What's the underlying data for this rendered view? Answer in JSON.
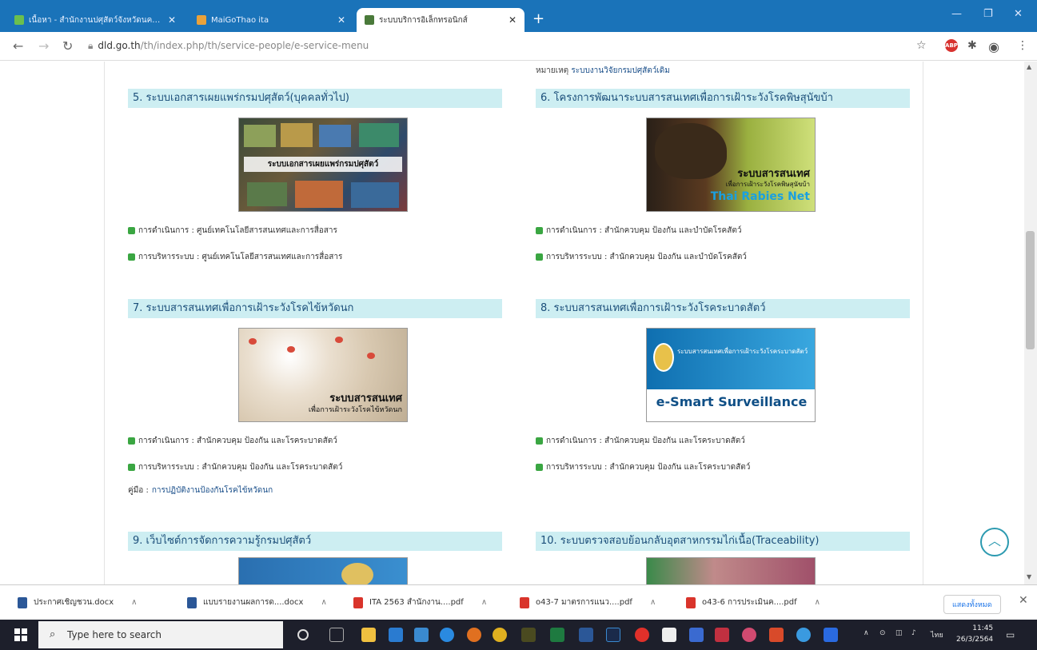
{
  "browser": {
    "tabs": [
      {
        "title": "เนื้อหา - สำนักงานปศุสัตว์จังหวัดนครราชสีมา",
        "active": false
      },
      {
        "title": "MaiGoThao ita",
        "active": false
      },
      {
        "title": "ระบบบริการอิเล็กทรอนิกส์",
        "active": true
      }
    ],
    "url_host": "dld.go.th",
    "url_path": "/th/index.php/th/service-people/e-service-menu"
  },
  "page": {
    "note_label": "หมายเหตุ",
    "note_link": "ระบบงานวิจัยกรมปศุสัตว์เดิม",
    "cards": [
      {
        "header": "5. ระบบเอกสารเผยแพร่กรมปศุสัตว์(บุคคลทั่วไป)",
        "image_text": "ระบบเอกสารเผยแพร่กรมปศุสัตว์",
        "operation": "การดำเนินการ : ศูนย์เทคโนโลยีสารสนเทศและการสื่อสาร",
        "admin": "การบริหารระบบ : ศูนย์เทคโนโลยีสารสนเทศและการสื่อสาร"
      },
      {
        "header": "6. โครงการพัฒนาระบบสารสนเทศเพื่อการเฝ้าระวังโรคพิษสุนัขบ้า",
        "image_text_1": "ระบบสารสนเทศ",
        "image_text_2": "เพื่อการเฝ้าระวังโรคพิษสุนัขบ้า",
        "image_text_3": "Thai Rabies Net",
        "operation": "การดำเนินการ : สำนักควบคุม ป้องกัน และบำบัดโรคสัตว์",
        "admin": "การบริหารระบบ : สำนักควบคุม ป้องกัน และบำบัดโรคสัตว์"
      },
      {
        "header": "7. ระบบสารสนเทศเพื่อการเฝ้าระวังโรคไข้หวัดนก",
        "image_text_1": "ระบบสารสนเทศ",
        "image_text_2": "เพื่อการเฝ้าระวังโรคไข้หวัดนก",
        "operation": "การดำเนินการ : สำนักควบคุม ป้องกัน และโรคระบาดสัตว์",
        "admin": "การบริหารระบบ : สำนักควบคุม ป้องกัน และโรคระบาดสัตว์",
        "manual_label": "คู่มือ :",
        "manual_link": "การปฏิบัติงานป้องกันโรคไข้หวัดนก"
      },
      {
        "header": "8. ระบบสารสนเทศเพื่อการเฝ้าระวังโรคระบาดสัตว์",
        "image_text_1": "ระบบสารสนเทศเพื่อการเฝ้าระวังโรคระบาดสัตว์",
        "image_text_2": "e-Smart Surveillance",
        "operation": "การดำเนินการ : สำนักควบคุม ป้องกัน และโรคระบาดสัตว์",
        "admin": "การบริหารระบบ : สำนักควบคุม ป้องกัน และโรคระบาดสัตว์"
      },
      {
        "header": "9. เว็บไซต์การจัดการความรู้กรมปศุสัตว์"
      },
      {
        "header": "10. ระบบตรวจสอบย้อนกลับอุตสาหกรรมไก่เนื้อ(Traceability)"
      }
    ]
  },
  "downloads": {
    "items": [
      {
        "name": "ประกาศเชิญชวน.docx",
        "kind": "docx"
      },
      {
        "name": "แบบรายงานผลการด....docx",
        "kind": "docx"
      },
      {
        "name": "ITA 2563 สำนักงาน....pdf",
        "kind": "pdf"
      },
      {
        "name": "o43-7 มาตรการแนว....pdf",
        "kind": "pdf"
      },
      {
        "name": "o43-6 การประเมินค....pdf",
        "kind": "pdf"
      }
    ],
    "show_all": "แสดงทั้งหมด"
  },
  "taskbar": {
    "search_placeholder": "Type here to search",
    "lang": "ไทย",
    "time": "11:45",
    "date": "26/3/2564"
  },
  "colors": {
    "tabbar": "#1a73b9",
    "card_header_bg": "#cdeef2",
    "card_header_text": "#1b4e7a",
    "bullet": "#3aa642"
  }
}
